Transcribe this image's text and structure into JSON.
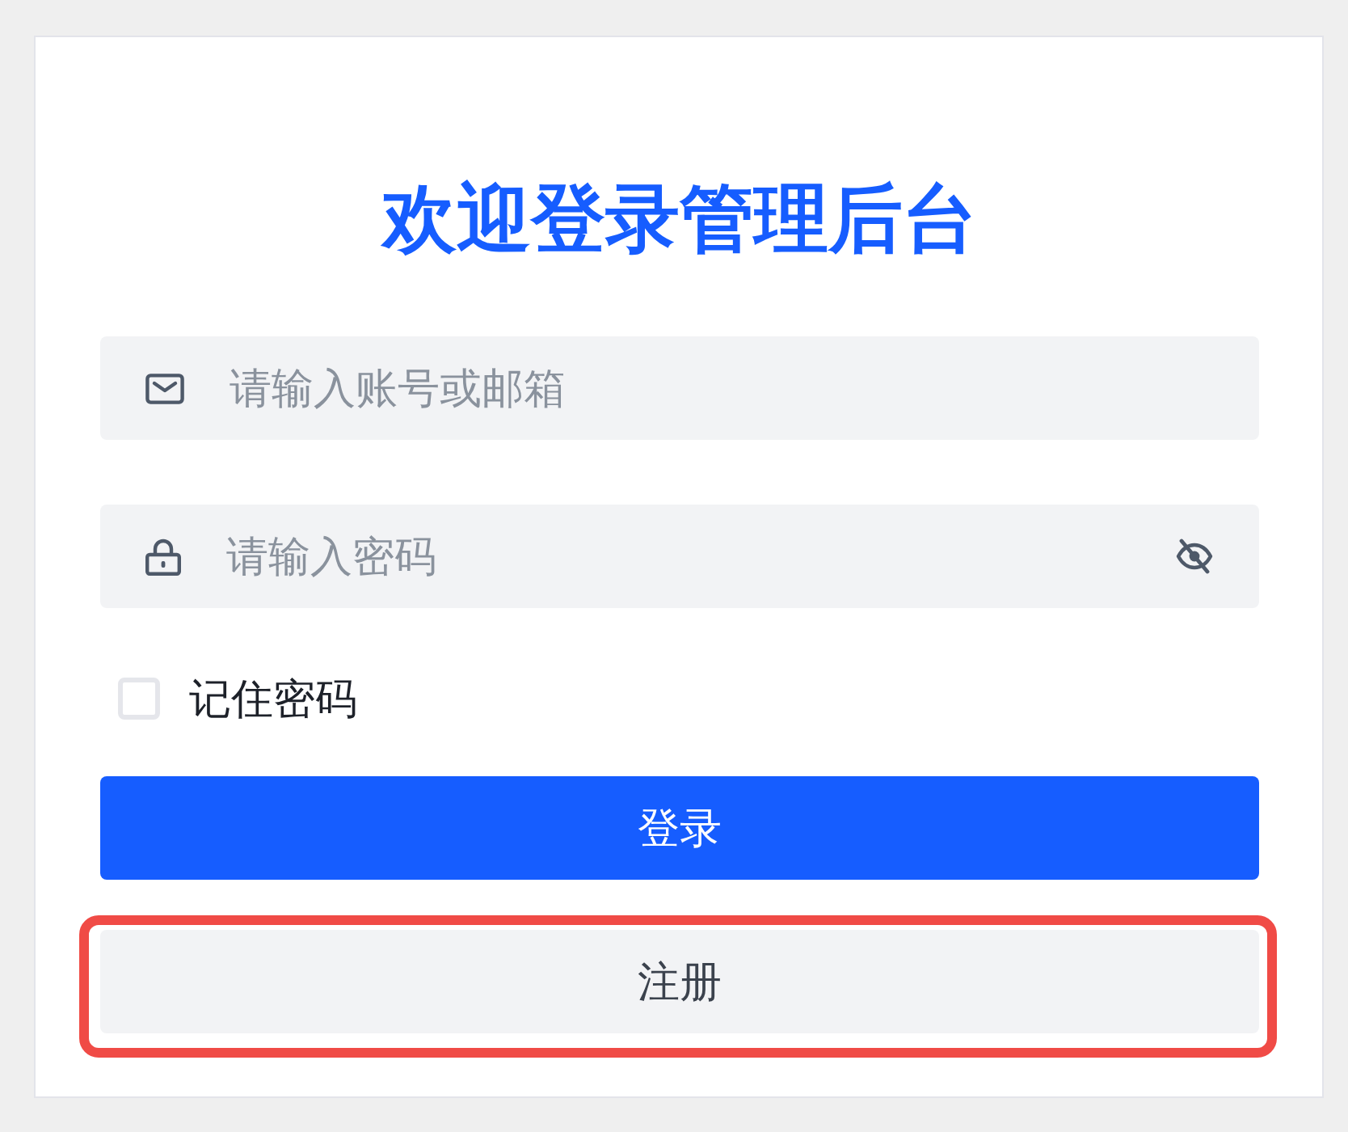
{
  "title": "欢迎登录管理后台",
  "fields": [
    {
      "kind": "email",
      "placeholder": "请输入账号或邮箱"
    },
    {
      "kind": "password",
      "placeholder": "请输入密码",
      "revealed": false
    }
  ],
  "remember": {
    "label": "记住密码",
    "checked": false
  },
  "buttons": [
    {
      "kind": "primary",
      "label": "登录",
      "highlighted": false
    },
    {
      "kind": "secondary",
      "label": "注册",
      "highlighted": true
    }
  ]
}
